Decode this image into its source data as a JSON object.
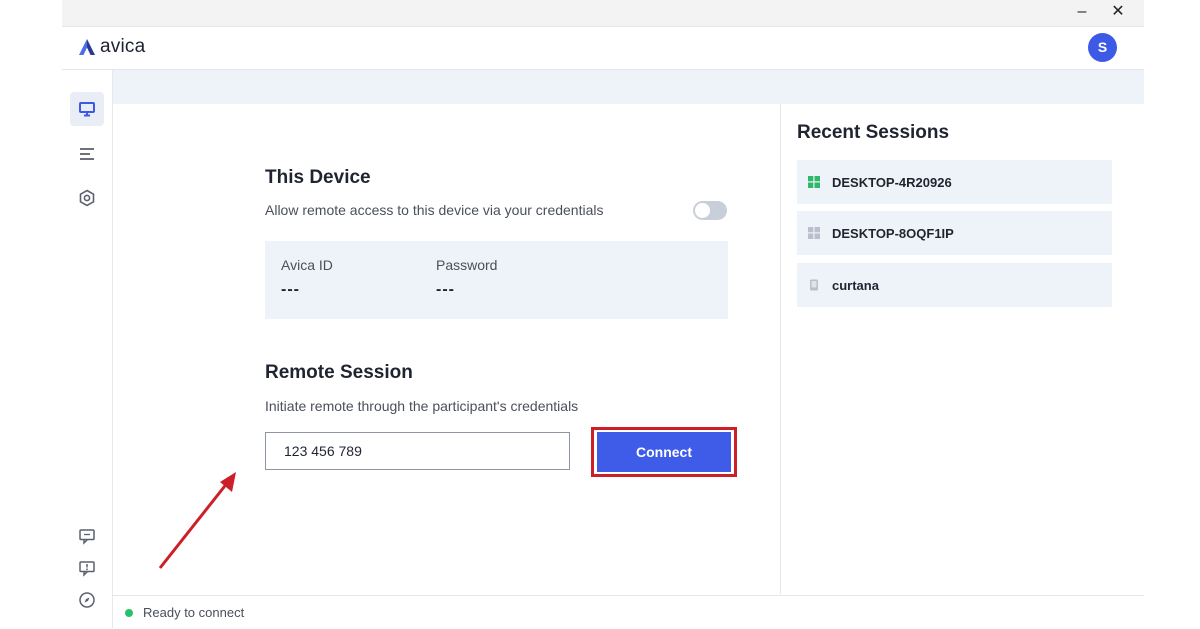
{
  "app": {
    "name": "avica",
    "user_initial": "S"
  },
  "window_controls": {
    "minimize": "–",
    "close": "✕"
  },
  "sidebar": {
    "items": [
      {
        "icon": "monitor-icon",
        "active": true
      },
      {
        "icon": "list-icon",
        "active": false
      },
      {
        "icon": "settings-hexagon-icon",
        "active": false
      }
    ],
    "bottom_items": [
      {
        "icon": "chat-icon"
      },
      {
        "icon": "feedback-icon"
      },
      {
        "icon": "compass-icon"
      }
    ]
  },
  "this_device": {
    "title": "This Device",
    "subtitle": "Allow remote access to this device via your credentials",
    "toggle_on": false,
    "id_label": "Avica ID",
    "id_value": "---",
    "password_label": "Password",
    "password_value": "---"
  },
  "remote_session": {
    "title": "Remote Session",
    "subtitle": "Initiate remote through the participant's credentials",
    "input_value": "123 456 789",
    "connect_label": "Connect"
  },
  "recent_sessions": {
    "title": "Recent Sessions",
    "items": [
      {
        "name": "DESKTOP-4R20926",
        "icon": "windows-icon",
        "color": "#2fb86a"
      },
      {
        "name": "DESKTOP-8OQF1IP",
        "icon": "windows-icon",
        "color": "#b9bfcc"
      },
      {
        "name": "curtana",
        "icon": "device-icon",
        "color": "#b9bfcc"
      }
    ]
  },
  "status": {
    "text": "Ready to connect",
    "color": "#27c06b"
  },
  "colors": {
    "accent": "#3f5ce8",
    "highlight": "#cc1f27",
    "panel": "#eef2f9"
  }
}
